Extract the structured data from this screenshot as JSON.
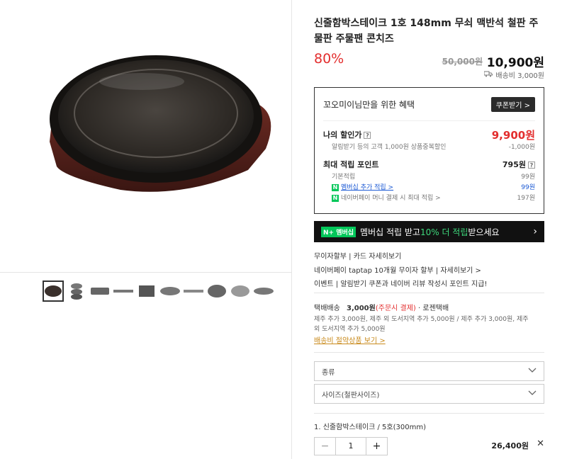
{
  "product": {
    "title": "신줄함박스테이크 1호 148mm 무쇠 맥반석 철판 주물판 주물팬 콘치즈",
    "discount": "80%",
    "original_price": "50,000원",
    "price": "10,900원",
    "shipping_fee": "배송비 3,000원"
  },
  "benefit": {
    "title": "꼬오미이님만을 위한 혜택",
    "coupon_button": "쿠폰받기 >",
    "my_discount_label": "나의 할인가",
    "my_discount_value": "9,900원",
    "my_discount_detail": "알림받기 등의 고객 1,000원 상품중복할인",
    "my_discount_detail_value": "-1,000원",
    "max_points_label": "최대 적립 포인트",
    "max_points_value": "795원",
    "basic_points_label": "기본적립",
    "basic_points_value": "99원",
    "membership_label": "멤버십 추가 적립 >",
    "membership_value": "99원",
    "npay_label": "네이버페이 머니 결제 시 최대 적립 >",
    "npay_value": "197원"
  },
  "banner": {
    "badge": "N+ 멤버십",
    "text_pre": "멤버십 적립 받고 ",
    "text_highlight": "10% 더 적립",
    "text_post": " 받으세요"
  },
  "installment": {
    "line1": "무이자할부 | 카드 자세히보기",
    "line2": "네이버페이 taptap 10개월 무이자 할부 | 자세히보기 >",
    "line3": "이벤트 | 알림받기 쿠폰과 네이버 리뷰 작성시 포인트 지급!"
  },
  "delivery": {
    "label": "택배배송",
    "fee": "3,000원",
    "fee_note": "(주문시 결제)",
    "carrier": "· 로젠택배",
    "extra_line1": "제주 추가 3,000원, 제주 외 도서지역 추가 5,000원 / 제주 추가 3,000원, 제주",
    "extra_line2": "외 도서지역 추가 5,000원",
    "link": "배송비 절약상품 보기 >"
  },
  "options": {
    "kind_placeholder": "종류",
    "size_placeholder": "사이즈(철판사이즈)"
  },
  "selected": {
    "item": "1. 신줄함박스테이크 / 5호(300mm)",
    "quantity": "1",
    "minus": "−",
    "plus": "+",
    "price": "26,400원",
    "remove": "✕"
  },
  "colors": {
    "accent_red": "#e32e2e",
    "naver_green": "#03c75a",
    "link_blue": "#1b59d4"
  }
}
